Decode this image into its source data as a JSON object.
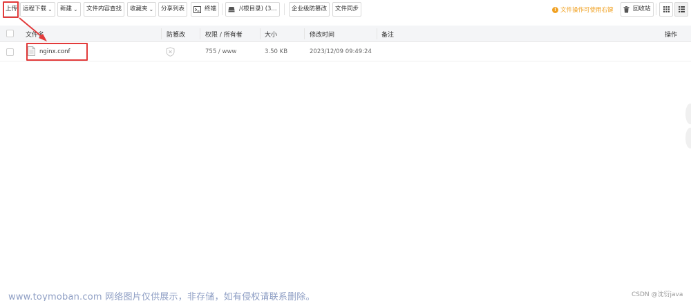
{
  "toolbar": {
    "upload": "上传",
    "remote_download": "远程下载",
    "new": "新建",
    "content_search": "文件内容查找",
    "favorites": "收藏夹",
    "share_list": "分享列表",
    "terminal": "终端",
    "path": "/(根目录) (3...",
    "enterprise_tamper": "企业级防篡改",
    "file_sync": "文件同步",
    "tip": "文件操作可使用右键",
    "recycle_bin": "回收站"
  },
  "table": {
    "columns": {
      "filename": "文件名",
      "tamper": "防篡改",
      "permission": "权限 / 所有者",
      "size": "大小",
      "modified": "修改时间",
      "note": "备注",
      "actions": "操作"
    },
    "rows": [
      {
        "name": "nginx.conf",
        "permission": "755 / www",
        "size": "3.50 KB",
        "modified": "2023/12/09 09:49:24"
      }
    ]
  },
  "footer": {
    "watermark": "www.toymoban.com 网络图片仅供展示，非存储，如有侵权请联系删除。",
    "credit": "CSDN @沈衍java"
  },
  "colors": {
    "highlight": "#e23a3a",
    "tip": "#f0a020",
    "header_bg": "#f4f5f7",
    "watermark": "#8e9ec4"
  }
}
